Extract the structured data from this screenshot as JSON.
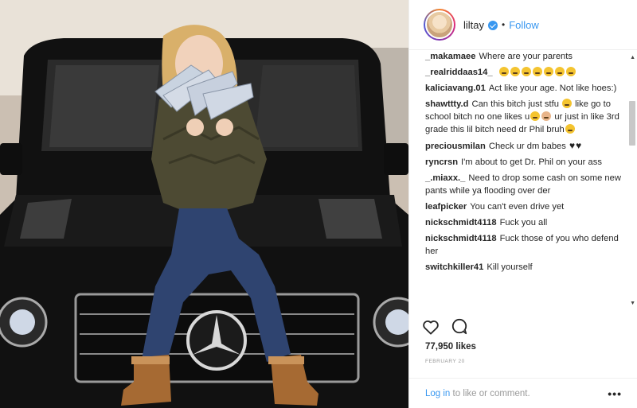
{
  "header": {
    "username": "liltay",
    "dot": "•",
    "follow_label": "Follow"
  },
  "comments": [
    {
      "user": "_makamaee",
      "text": "Where are your parents"
    },
    {
      "user": "_realriddaas14_",
      "text": ""
    },
    {
      "user": "kaliciavang.01",
      "text": "Act like your age. Not like hoes:)"
    },
    {
      "user": "shawttty.d",
      "text_a": "Can this bitch just stfu",
      "text_b": " like go to school bitch no one likes u",
      "text_c": " ur just in like 3rd grade this lil bitch need dr Phil bruh"
    },
    {
      "user": "preciousmilan",
      "text": "Check ur dm babes"
    },
    {
      "user": "ryncrsn",
      "text": "I'm about to get Dr. Phil on your ass"
    },
    {
      "user": "_.miaxx._",
      "text": "Need to drop some cash on some new pants while ya flooding over der"
    },
    {
      "user": "leafpicker",
      "text": "You can't even drive yet"
    },
    {
      "user": "nickschmidt4118",
      "text": "Fuck you all"
    },
    {
      "user": "nickschmidt4118",
      "text": "Fuck those of you who defend her"
    },
    {
      "user": "switchkiller41",
      "text": "Kill yourself"
    }
  ],
  "icons": {
    "like": "heart-outline-icon",
    "comment": "speech-bubble-icon",
    "emoji": "grimacing-face-emoji",
    "heart": "black-heart-emoji"
  },
  "likes": "77,950 likes",
  "date": "FEBRUARY 20",
  "footer": {
    "login_link": "Log in",
    "login_text": " to like or comment.",
    "more": "•••"
  },
  "colors": {
    "accent": "#3897f0",
    "text": "#262626",
    "muted": "#999999",
    "border": "#efefef"
  }
}
